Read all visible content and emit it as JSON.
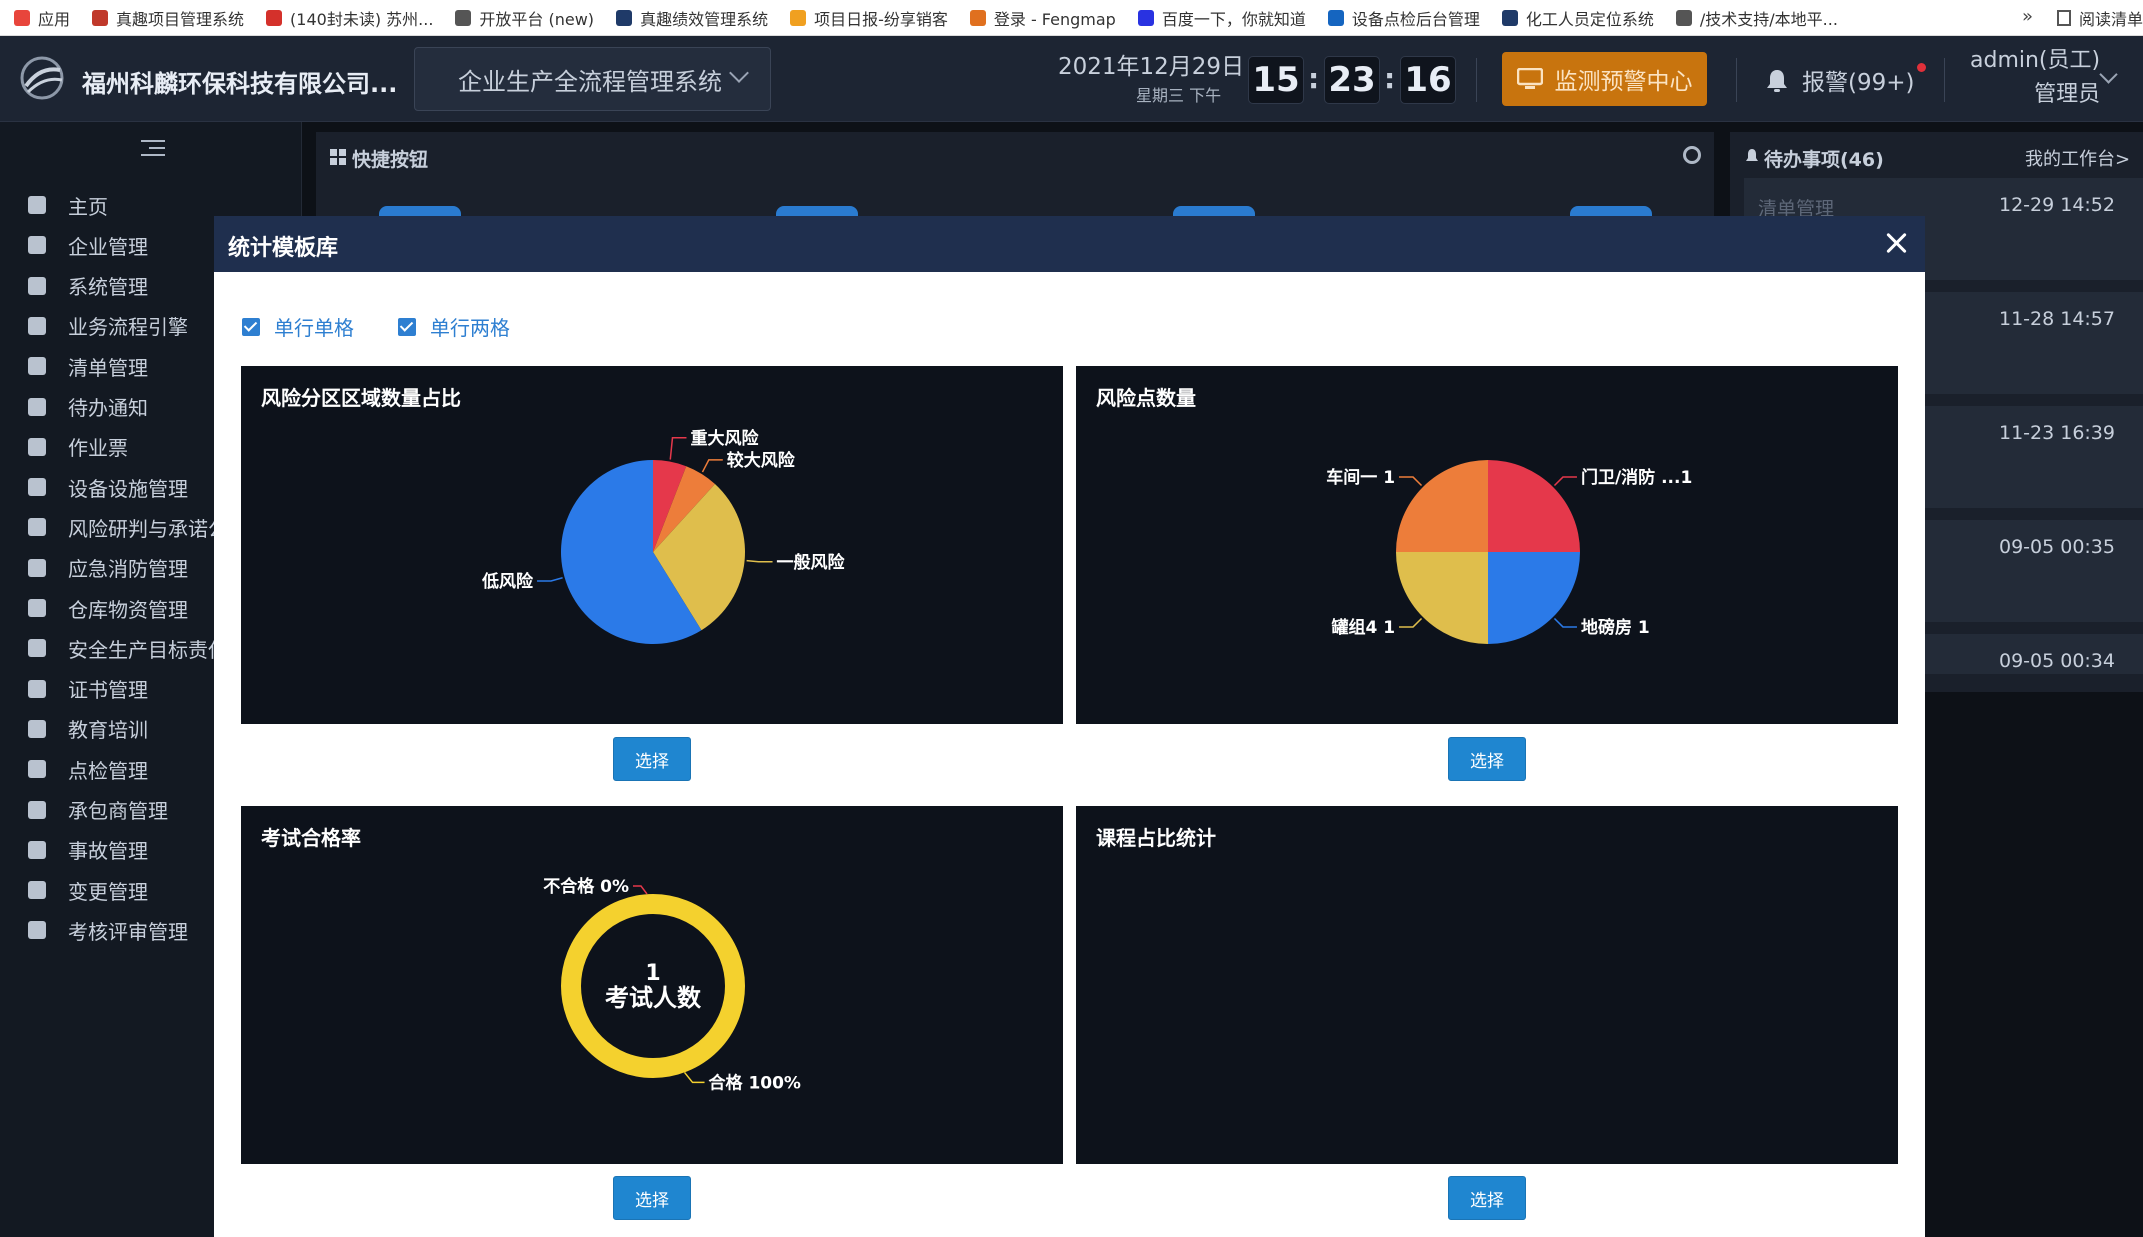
{
  "bookmarks": [
    {
      "label": "应用",
      "icon": "apps-grid-icon",
      "color": "#e8453c"
    },
    {
      "label": "真趣项目管理系统",
      "icon": "project-icon",
      "color": "#c0392b"
    },
    {
      "label": "(140封未读) 苏州...",
      "icon": "mail-icon",
      "color": "#d4312b"
    },
    {
      "label": "开放平台 (new)",
      "icon": "globe-icon",
      "color": "#555555"
    },
    {
      "label": "真趣绩效管理系统",
      "icon": "performance-icon",
      "color": "#1f3a68"
    },
    {
      "label": "项目日报-纷享销客",
      "icon": "report-icon",
      "color": "#f0a020"
    },
    {
      "label": "登录 - Fengmap",
      "icon": "map-pin-icon",
      "color": "#e0701f"
    },
    {
      "label": "百度一下，你就知道",
      "icon": "baidu-icon",
      "color": "#2932e1"
    },
    {
      "label": "设备点检后台管理",
      "icon": "check-icon",
      "color": "#1565c0"
    },
    {
      "label": "化工人员定位系统",
      "icon": "locate-icon",
      "color": "#1f3a68"
    },
    {
      "label": "/技术支持/本地平...",
      "icon": "globe-icon",
      "color": "#555555"
    }
  ],
  "bookmarks_more": "»",
  "reading_list": "阅读清单",
  "header": {
    "company": "福州科麟环保科技有限公司...",
    "system_select": "企业生产全流程管理系统",
    "date": "2021年12月29日",
    "weekday": "星期三  下午",
    "time_h": "15",
    "time_m": "23",
    "time_s": "16",
    "time_sep": ":",
    "monitor_btn": "监测预警中心",
    "alarm": "报警(99+)",
    "user_name": "admin(员工)",
    "user_role": "管理员"
  },
  "sidebar": {
    "items": [
      {
        "label": "主页",
        "icon": "home-icon"
      },
      {
        "label": "企业管理",
        "icon": "building-icon"
      },
      {
        "label": "系统管理",
        "icon": "settings-icon"
      },
      {
        "label": "业务流程引擎",
        "icon": "workflow-icon"
      },
      {
        "label": "清单管理",
        "icon": "list-icon"
      },
      {
        "label": "待办通知",
        "icon": "envelope-icon"
      },
      {
        "label": "作业票",
        "icon": "ticket-icon"
      },
      {
        "label": "设备设施管理",
        "icon": "equipment-icon"
      },
      {
        "label": "风险研判与承诺公",
        "icon": "briefcase-icon"
      },
      {
        "label": "应急消防管理",
        "icon": "extinguisher-icon"
      },
      {
        "label": "仓库物资管理",
        "icon": "warehouse-icon"
      },
      {
        "label": "安全生产目标责任",
        "icon": "target-icon"
      },
      {
        "label": "证书管理",
        "icon": "certificate-icon"
      },
      {
        "label": "教育培训",
        "icon": "user-icon"
      },
      {
        "label": "点检管理",
        "icon": "edit-icon"
      },
      {
        "label": "承包商管理",
        "icon": "user-icon"
      },
      {
        "label": "事故管理",
        "icon": "accident-icon"
      },
      {
        "label": "变更管理",
        "icon": "change-icon"
      },
      {
        "label": "考核评审管理",
        "icon": "user-icon"
      }
    ]
  },
  "workspace": {
    "quick_title": "快捷按钮",
    "todo_title": "待办事项(46)",
    "todo_link": "我的工作台>",
    "todo_items": [
      {
        "label": "清单管理",
        "time": "12-29 14:52"
      },
      {
        "label": "",
        "time": "11-28 14:57"
      },
      {
        "label": "",
        "time": "11-23 16:39"
      },
      {
        "label": "",
        "time": "09-05 00:35"
      },
      {
        "label": "",
        "time": "09-05 00:34"
      }
    ]
  },
  "modal": {
    "title": "统计模板库",
    "checkboxes": [
      {
        "label": "单行单格",
        "checked": true
      },
      {
        "label": "单行两格",
        "checked": true
      }
    ],
    "select_label": "选择",
    "cards": [
      {
        "title": "风险分区区域数量占比"
      },
      {
        "title": "风险点数量"
      },
      {
        "title": "考试合格率",
        "center_value": "1",
        "center_label": "考试人数"
      },
      {
        "title": "课程占比统计"
      }
    ]
  },
  "chart_data": [
    {
      "type": "pie",
      "title": "风险分区区域数量占比",
      "categories": [
        "重大风险",
        "较大风险",
        "一般风险",
        "低风险"
      ],
      "values": [
        1,
        1,
        5,
        10
      ],
      "colors": [
        "#e5384b",
        "#ed7d3a",
        "#dfbe4c",
        "#2b7ae8"
      ]
    },
    {
      "type": "pie",
      "title": "风险点数量",
      "categories": [
        "门卫/消防 ...",
        "地磅房",
        "罐组4",
        "车间一"
      ],
      "values": [
        1,
        1,
        1,
        1
      ],
      "labels": [
        "门卫/消防 ...1",
        "地磅房 1",
        "罐组4 1",
        "车间一 1"
      ],
      "colors": [
        "#e5384b",
        "#2b7ae8",
        "#dfbe4c",
        "#ed7d3a"
      ]
    },
    {
      "type": "pie",
      "title": "考试合格率",
      "categories": [
        "合格",
        "不合格"
      ],
      "values": [
        100,
        0
      ],
      "labels": [
        "合格 100%",
        "不合格 0%"
      ],
      "colors": [
        "#f4d12e",
        "#e5384b"
      ]
    },
    {
      "type": "pie",
      "title": "课程占比统计",
      "categories": [],
      "values": []
    }
  ]
}
